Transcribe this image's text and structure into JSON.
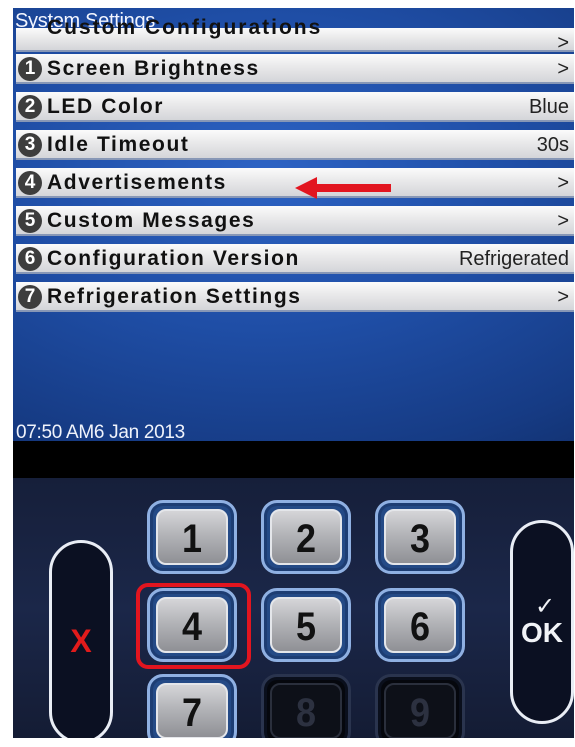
{
  "screen": {
    "title": "System Settings",
    "cut_row_label": "Custom Configurations",
    "cut_row_value": ">",
    "datetime": "07:50 AM6 Jan 2013"
  },
  "menu": [
    {
      "num": "1",
      "label": "Screen Brightness",
      "value": ">"
    },
    {
      "num": "2",
      "label": "LED Color",
      "value": "Blue"
    },
    {
      "num": "3",
      "label": "Idle Timeout",
      "value": "30s"
    },
    {
      "num": "4",
      "label": "Advertisements",
      "value": ">"
    },
    {
      "num": "5",
      "label": "Custom Messages",
      "value": ">"
    },
    {
      "num": "6",
      "label": "Configuration Version",
      "value": "Refrigerated"
    },
    {
      "num": "7",
      "label": "Refrigeration Settings",
      "value": ">"
    }
  ],
  "keypad": {
    "cancel": "X",
    "ok_check": "✓",
    "ok": "OK",
    "keys": [
      "1",
      "2",
      "3",
      "4",
      "5",
      "6",
      "7",
      "8",
      "9"
    ]
  },
  "colors": {
    "annotation_red": "#e2151f",
    "screen_blue": "#1f4ea6"
  }
}
